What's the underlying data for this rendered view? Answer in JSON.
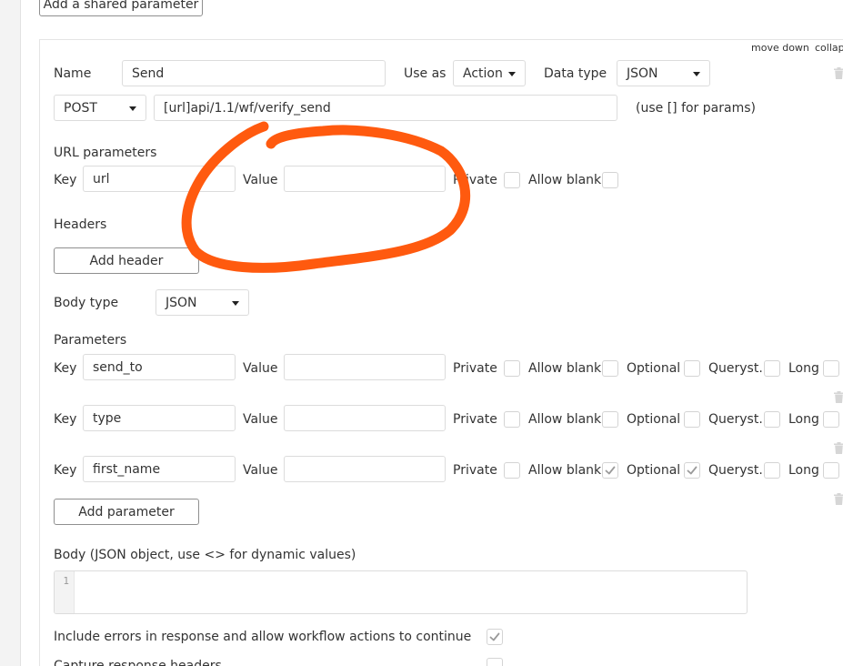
{
  "top": {
    "add_shared_param_label": "Add a shared parameter"
  },
  "actions": {
    "move_down": "move down",
    "collapse": "collap"
  },
  "call": {
    "name_label": "Name",
    "name_value": "Send",
    "use_as_label": "Use as",
    "use_as_value": "Action",
    "data_type_label": "Data type",
    "data_type_value": "JSON",
    "method_value": "POST",
    "url_value": "[url]api/1.1/wf/verify_send",
    "url_hint": "(use [] for params)"
  },
  "url_params": {
    "section_label": "URL parameters",
    "key_label": "Key",
    "key_value": "url",
    "value_label": "Value",
    "value_value": "",
    "private_label": "Private",
    "allow_blank_label": "Allow blank"
  },
  "headers": {
    "section_label": "Headers",
    "add_label": "Add header"
  },
  "body_type": {
    "label": "Body type",
    "value": "JSON"
  },
  "parameters": {
    "section_label": "Parameters",
    "labels": {
      "key": "Key",
      "value": "Value",
      "private": "Private",
      "allow_blank": "Allow blank",
      "optional": "Optional",
      "queryst": "Queryst.",
      "long": "Long"
    },
    "rows": [
      {
        "key": "send_to",
        "value": "",
        "private": false,
        "allow_blank": false,
        "optional": false,
        "queryst": false,
        "long": false
      },
      {
        "key": "type",
        "value": "",
        "private": false,
        "allow_blank": false,
        "optional": false,
        "queryst": false,
        "long": false
      },
      {
        "key": "first_name",
        "value": "",
        "private": false,
        "allow_blank": true,
        "optional": true,
        "queryst": false,
        "long": false
      }
    ],
    "add_label": "Add parameter"
  },
  "body": {
    "label": "Body (JSON object, use <> for dynamic values)",
    "line_number": "1",
    "content": ""
  },
  "options": {
    "include_errors_label": "Include errors in response and allow workflow actions to continue",
    "include_errors_checked": true,
    "capture_headers_label": "Capture response headers",
    "capture_headers_checked": false
  },
  "colors": {
    "annotation": "#ff5a0f",
    "button_border": "#8f8f8f",
    "field_border": "#dcdcdc",
    "check": "#9a9a9a"
  },
  "icons": {
    "trash": "trash-icon",
    "dropdown": "chevron-down-icon",
    "check": "check-icon"
  }
}
